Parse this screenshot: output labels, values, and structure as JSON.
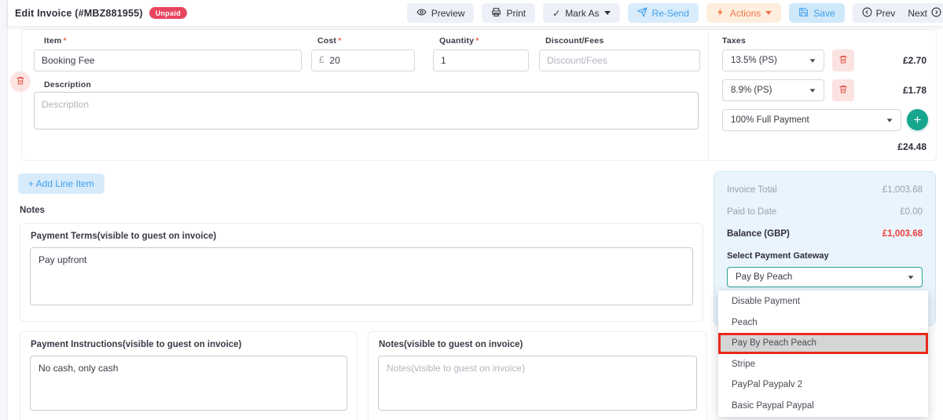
{
  "header": {
    "title": "Edit Invoice (#MBZ881955)",
    "status_badge": "Unpaid",
    "toolbar": {
      "preview": "Preview",
      "print": "Print",
      "mark_as": "Mark As",
      "resend": "Re-Send",
      "actions": "Actions",
      "save": "Save",
      "prev": "Prev",
      "next": "Next"
    }
  },
  "line_item": {
    "item_label": "Item",
    "item_value": "Booking Fee",
    "cost_label": "Cost",
    "currency_symbol": "£",
    "cost_value": "20",
    "quantity_label": "Quantity",
    "quantity_value": "1",
    "discount_label": "Discount/Fees",
    "discount_placeholder": "Discount/Fees",
    "description_label": "Description",
    "description_placeholder": "Description",
    "required_marker": "*"
  },
  "taxes": {
    "label": "Taxes",
    "rows": [
      {
        "name": "13.5% (PS)",
        "amount": "£2.70"
      },
      {
        "name": "8.9% (PS)",
        "amount": "£1.78"
      }
    ],
    "payment_schedule": "100% Full Payment",
    "line_total": "£24.48"
  },
  "add_line_item_label": "+ Add Line Item",
  "notes_section": {
    "heading": "Notes",
    "payment_terms_label": "Payment Terms(visible to guest on invoice)",
    "payment_terms_value": "Pay upfront",
    "payment_instructions_label": "Payment Instructions(visible to guest on invoice)",
    "payment_instructions_value": "No cash, only cash",
    "notes_label": "Notes(visible to guest on invoice)",
    "notes_placeholder": "Notes(visible to guest on invoice)"
  },
  "summary": {
    "invoice_total_label": "Invoice Total",
    "invoice_total_value": "£1,003.68",
    "paid_to_date_label": "Paid to Date",
    "paid_to_date_value": "£0.00",
    "balance_label": "Balance (GBP)",
    "balance_value": "£1,003.68",
    "gateway_label": "Select Payment Gateway",
    "gateway_selected": "Pay By Peach"
  },
  "gateway_dropdown": {
    "options": [
      {
        "label": "Disable Payment",
        "highlighted": false
      },
      {
        "label": "Peach",
        "highlighted": false
      },
      {
        "label": "Pay By Peach Peach",
        "highlighted": true
      },
      {
        "label": "Stripe",
        "highlighted": false
      },
      {
        "label": "PayPal Paypalv 2",
        "highlighted": false
      },
      {
        "label": "Basic Paypal Paypal",
        "highlighted": false
      }
    ]
  },
  "colors": {
    "accent_blue": "#3f9fe9",
    "accent_orange": "#f2784b",
    "status_red": "#e8455f",
    "balance_red": "#f23d3d",
    "teal": "#17a58c",
    "select_focus_teal": "#2aa394",
    "highlight_border_red": "#e8291c"
  }
}
